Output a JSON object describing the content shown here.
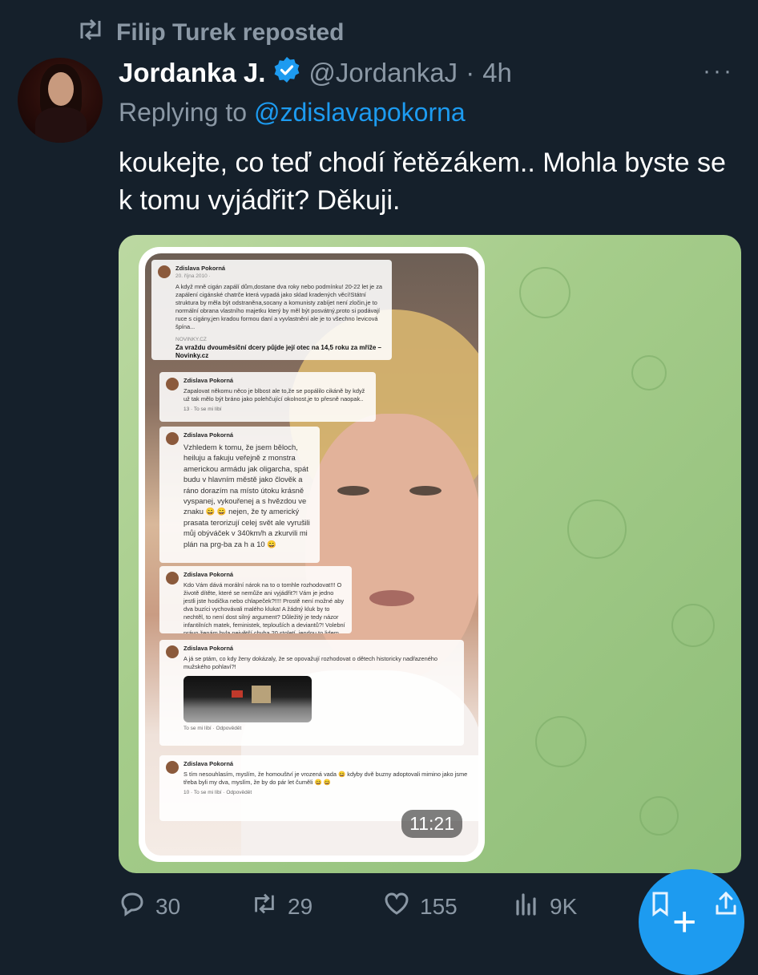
{
  "repost": {
    "label": "Filip Turek reposted",
    "icon": "repost-icon"
  },
  "tweet": {
    "author_name": "Jordanka J.",
    "handle": "@JordankaJ",
    "separator": "·",
    "time": "4h",
    "more": "···",
    "reply_prefix": "Replying to",
    "reply_mention": "@zdislavapokorna",
    "text": "koukejte, co teď chodí řetězákem.. Mohla byste se k tomu vyjádřit? Děkuji.",
    "verified_color": "#1d9bf0"
  },
  "media": {
    "timestamp": "11:21",
    "cards": [
      {
        "name": "Zdislava Pokorná",
        "date": "20. října 2010 · ",
        "body": "A když mně cigán zapálí dům,dostane dva roky nebo podmínku! 20-22 let je za zapálení cigánské chatrče která vypadá jako sklad kradených věcí!Státní struktura by měla být odstraněna,socany a komunisty zabíjet není zločin,je to normální obrana vlastního majetku který by měl být posvátný,proto si podávají ruce s cigány,jen kradou formou daní a vyvlastnění ale je to všechno levicová špína...",
        "link_source": "NOVINKY.CZ",
        "link_title": "Za vraždu dvouměsíční dcery půjde její otec na 14,5 roku za mříže – Novinky.cz"
      },
      {
        "name": "Zdislava Pokorná",
        "body": "Zapalovat někomu něco je blbost ale to,že se popálilo cikáně by když už tak mělo být bráno jako polehčující okolnost,je to přesně naopak..",
        "footer": "13 · To se mi líbí"
      },
      {
        "name": "Zdislava Pokorná",
        "body": "Vzhledem k tomu, že jsem běloch, heiluju a fakuju veřejně z monstra americkou armádu jak oligarcha, spát budu v hlavním městě jako člověk a ráno dorazím na místo útoku krásně vyspanej, vykouřenej a s hvězdou ve znaku 😄 😄 nejen, že ty americký prasata terorizují celej svět ale vyrušili můj obýváček v 340km/h a zkurvili mi plán na prg-ba za h a 10 😄"
      },
      {
        "name": "Zdislava Pokorná",
        "body": "Kdo Vám dává morální nárok na to o tomhle rozhodovat!!! O životě dítěte, které se nemůže ani vyjádřit?! Vám je jedno jestli jste hodička nebo chlapeček?!!!! Prostě není možné aby dva buzíci vychovávali malého kluka! A žádný kluk by to nechtěl, to není dost silný argument? Důležitý je tedy názor infantilních matek, feministek, teplouších a deviantů?! Volební právo ženám byla největší chyba 20.století, jendou to lidem dojde 😄"
      },
      {
        "name": "Zdislava Pokorná",
        "body": "A já se ptám, co kdy ženy dokázaly, že se opovažují rozhodovat o dětech historicky nadřazeného mužského pohlaví?!",
        "footer": "To se mi líbí · Odpovědět"
      },
      {
        "name": "Zdislava Pokorná",
        "body": "S tím nesouhlasím, myslím, že homouštví je vrozená vada 😄 kdyby dvě buzny adoptovali mimino jako jsme třeba byli my dva, myslím, že by do pár let čuměli 😄 😄",
        "footer": "10 · To se mi líbí · Odpovědět"
      }
    ]
  },
  "actions": {
    "replies": "30",
    "reposts": "29",
    "likes": "155",
    "views": "9K"
  },
  "fab": {
    "label": "+"
  }
}
